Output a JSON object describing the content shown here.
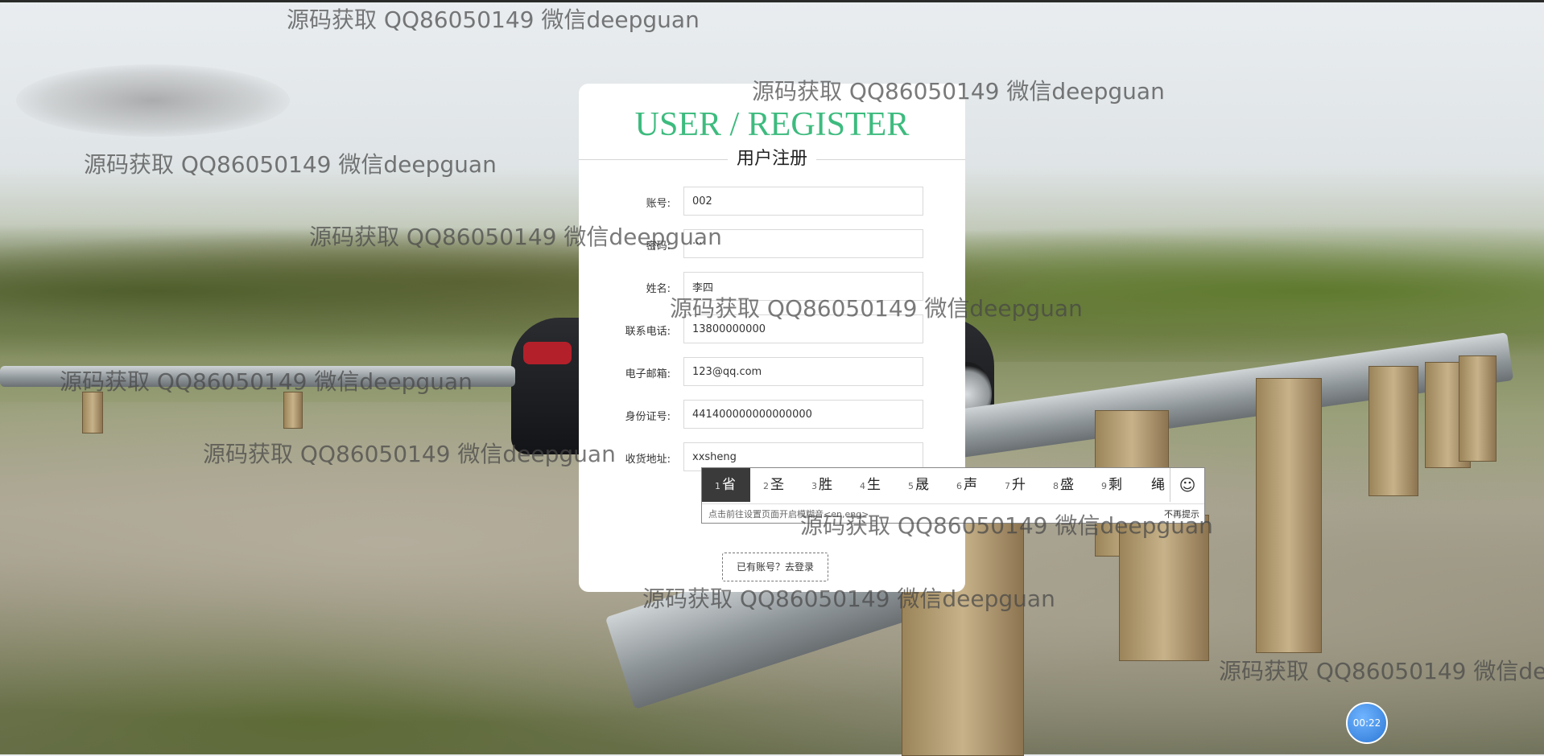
{
  "form": {
    "title_en": "USER / REGISTER",
    "title_cn": "用户注册",
    "fields": [
      {
        "label": "账号:",
        "value": "002"
      },
      {
        "label": "密码:",
        "value": "···"
      },
      {
        "label": "姓名:",
        "value": "李四"
      },
      {
        "label": "联系电话:",
        "value": "13800000000"
      },
      {
        "label": "电子邮箱:",
        "value": "123@qq.com"
      },
      {
        "label": "身份证号:",
        "value": "441400000000000000"
      },
      {
        "label": "收货地址:",
        "value": "xxsheng"
      }
    ],
    "login_link": "已有账号？去登录"
  },
  "ime": {
    "candidates": [
      {
        "num": "1",
        "text": "省"
      },
      {
        "num": "2",
        "text": "圣"
      },
      {
        "num": "3",
        "text": "胜"
      },
      {
        "num": "4",
        "text": "生"
      },
      {
        "num": "5",
        "text": "晟"
      },
      {
        "num": "6",
        "text": "声"
      },
      {
        "num": "7",
        "text": "升"
      },
      {
        "num": "8",
        "text": "盛"
      },
      {
        "num": "9",
        "text": "剩"
      },
      {
        "num": "",
        "text": "绳"
      }
    ],
    "emoji_icon": "smiley-icon",
    "hint": "点击前往设置页面开启模糊音<en,eng>",
    "dismiss": "不再提示"
  },
  "watermark": "源码获取 QQ86050149 微信deepguan",
  "timer": "00:22"
}
